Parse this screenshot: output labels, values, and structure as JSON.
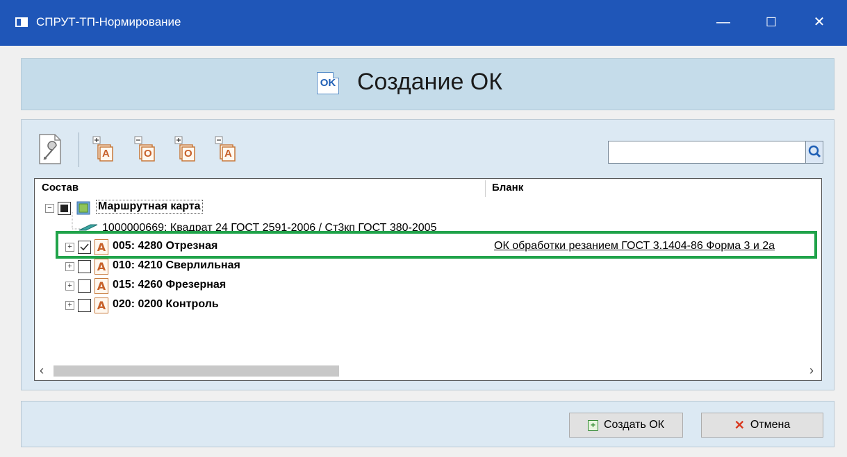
{
  "window": {
    "title": "СПРУТ-ТП-Нормирование",
    "minimize_glyph": "—",
    "maximize_glyph": "☐",
    "close_glyph": "✕"
  },
  "header": {
    "icon_text": "OK",
    "title": "Создание ОК"
  },
  "toolbar": {
    "icons": [
      "wrench-settings-icon",
      "expand-a-icon",
      "collapse-o-icon",
      "expand-o-icon",
      "collapse-a-icon"
    ],
    "icon_letters": [
      "А",
      "О",
      "О",
      "А"
    ],
    "search_value": ""
  },
  "tree": {
    "columns": [
      "Состав",
      "Бланк"
    ],
    "root": {
      "label": "Маршрутная карта",
      "checked": "partial"
    },
    "material": "1000000669: Квадрат 24 ГОСТ 2591-2006 / Ст3кп ГОСТ 380-2005",
    "operations": [
      {
        "label": "005: 4280 Отрезная",
        "checked": true,
        "icon": "А",
        "blank": "ОК обработки резанием ГОСТ 3.1404-86 Форма 3 и 2а"
      },
      {
        "label": "010: 4210 Сверлильная",
        "checked": false,
        "icon": "А",
        "blank": ""
      },
      {
        "label": "015: 4260 Фрезерная",
        "checked": false,
        "icon": "А",
        "blank": ""
      },
      {
        "label": "020: 0200 Контроль",
        "checked": false,
        "icon": "А",
        "blank": ""
      }
    ]
  },
  "footer": {
    "create_label": "Создать ОК",
    "cancel_label": "Отмена"
  },
  "colors": {
    "titlebar": "#1f56b8",
    "header_bg": "#c5dcea",
    "highlight": "#20a34a",
    "link": "#0033cc"
  }
}
